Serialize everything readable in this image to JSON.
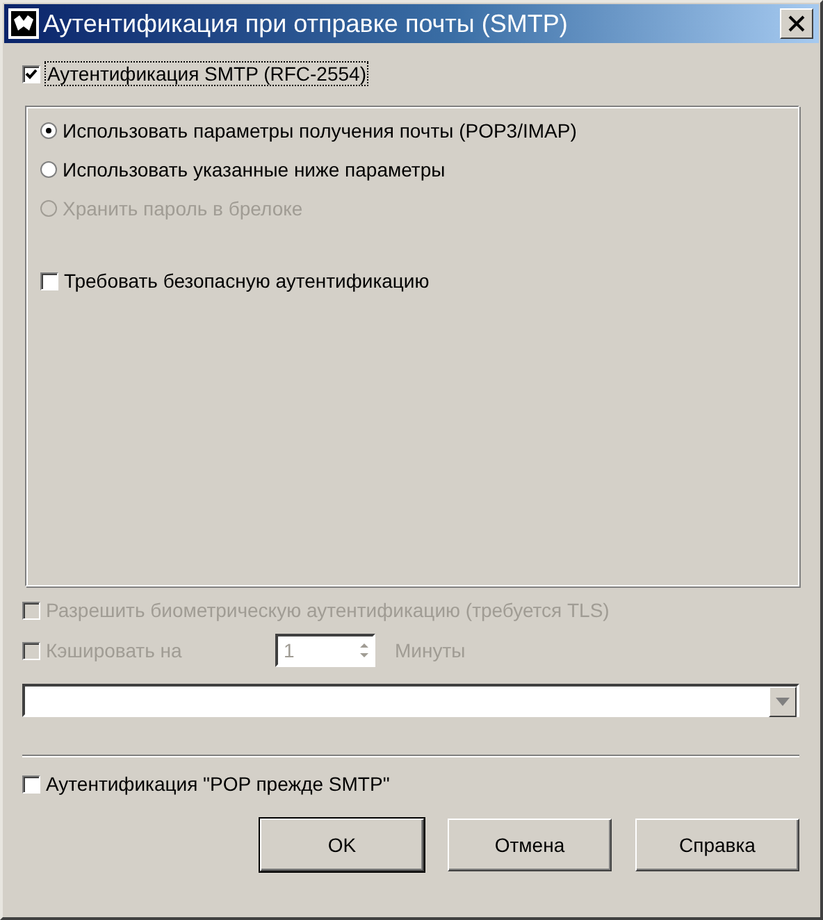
{
  "window": {
    "title": "Аутентификация при отправке почты (SMTP)"
  },
  "smtp_auth": {
    "label": "Аутентификация SMTP (RFC-2554)",
    "checked": true,
    "disabled": false
  },
  "credential_options": [
    {
      "label": "Использовать параметры получения почты (POP3/IMAP)",
      "selected": true,
      "disabled": false
    },
    {
      "label": "Использовать указанные ниже параметры",
      "selected": false,
      "disabled": false
    },
    {
      "label": "Хранить пароль в брелоке",
      "selected": false,
      "disabled": true
    }
  ],
  "secure_auth": {
    "label": "Требовать безопасную аутентификацию",
    "checked": false,
    "disabled": false
  },
  "biometric": {
    "label": "Разрешить биометрическую аутентификацию (требуется TLS)",
    "checked": false,
    "disabled": true
  },
  "cache": {
    "label": "Кэшировать на",
    "checked": false,
    "disabled": true,
    "value": "1",
    "unit": "Минуты"
  },
  "pop_before_smtp": {
    "label": "Аутентификация \"POP прежде SMTP\"",
    "checked": false,
    "disabled": false
  },
  "buttons": [
    {
      "label": "OK",
      "default": true
    },
    {
      "label": "Отмена",
      "default": false
    },
    {
      "label": "Справка",
      "default": false
    }
  ]
}
